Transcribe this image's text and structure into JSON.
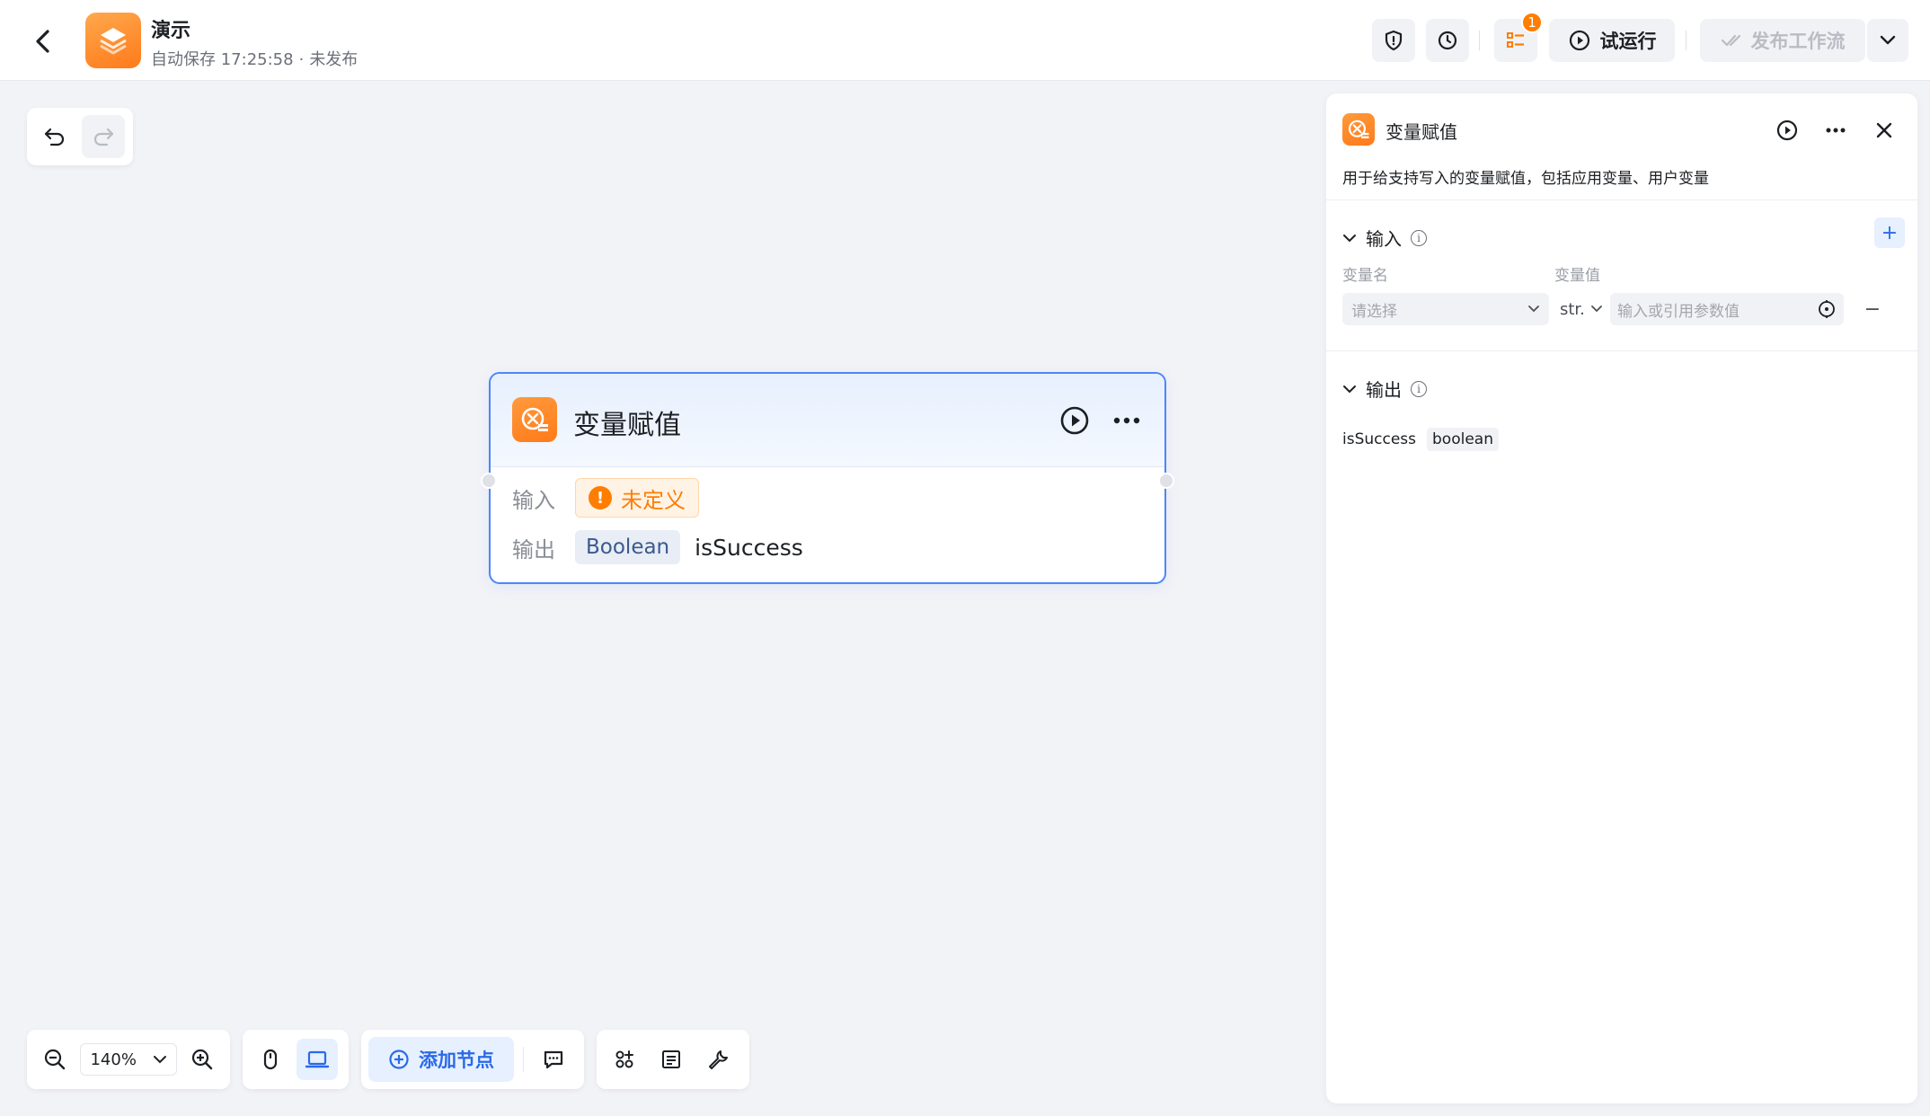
{
  "header": {
    "app_name": "演示",
    "autosave": "自动保存 17:25:58",
    "publish_status": "未发布",
    "separator": "·",
    "issues_count": "1",
    "run_label": "试运行",
    "publish_label": "发布工作流"
  },
  "node": {
    "title": "变量赋值",
    "input_label": "输入",
    "input_status": "未定义",
    "output_label": "输出",
    "output_type": "Boolean",
    "output_name": "isSuccess"
  },
  "toolbar": {
    "zoom": "140%",
    "add_node": "添加节点"
  },
  "panel": {
    "title": "变量赋值",
    "description": "用于给支持写入的变量赋值，包括应用变量、用户变量",
    "input_section": "输入",
    "col_name": "变量名",
    "col_value": "变量值",
    "name_placeholder": "请选择",
    "type_value": "str.",
    "value_placeholder": "输入或引用参数值",
    "output_section": "输出",
    "output_name": "isSuccess",
    "output_type": "boolean"
  },
  "colors": {
    "accent": "#4d86f7",
    "brand_orange": "#ff7d00",
    "primary_blue": "#2a6ae8"
  }
}
